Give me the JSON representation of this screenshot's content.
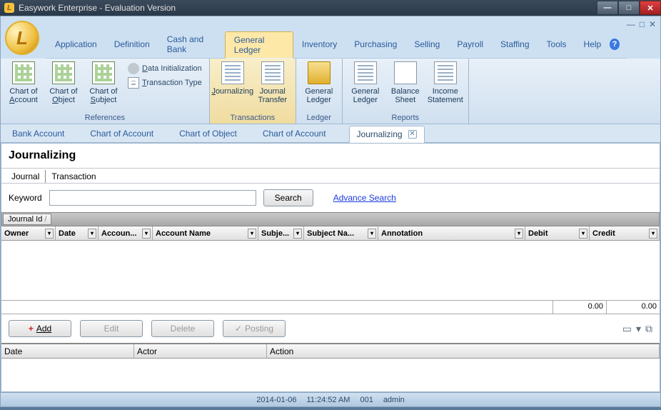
{
  "window_title": "Easywork Enterprise - Evaluation Version",
  "logo_letter": "L",
  "menu": [
    "Application",
    "Definition",
    "Cash and Bank",
    "General Ledger",
    "Inventory",
    "Purchasing",
    "Selling",
    "Payroll",
    "Staffing",
    "Tools",
    "Help"
  ],
  "menu_active": 3,
  "ribbon": {
    "references": {
      "label": "References",
      "items": [
        "Chart of Account",
        "Chart of Object",
        "Chart of Subject"
      ],
      "side": [
        "Data Initialization",
        "Transaction Type"
      ]
    },
    "transactions": {
      "label": "Transactions",
      "items": [
        "Journalizing",
        "Journal Transfer"
      ]
    },
    "ledger": {
      "label": "Ledger",
      "items": [
        "General Ledger"
      ]
    },
    "reports": {
      "label": "Reports",
      "items": [
        "General Ledger",
        "Balance Sheet",
        "Income Statement"
      ]
    }
  },
  "subtabs": [
    "Bank Account",
    "Chart of Account",
    "Chart of Object",
    "Chart of Account",
    "Journalizing"
  ],
  "subtab_active": 4,
  "page": {
    "title": "Journalizing",
    "inner_tabs": [
      "Journal",
      "Transaction"
    ],
    "keyword_label": "Keyword",
    "search_btn": "Search",
    "adv_search": "Advance Search"
  },
  "grid": {
    "group_col": "Journal Id",
    "columns": [
      "Owner",
      "Date",
      "Accoun...",
      "Account Name",
      "Subje...",
      "Subject Na...",
      "Annotation",
      "Debit",
      "Credit"
    ],
    "sums": {
      "debit": "0.00",
      "credit": "0.00"
    }
  },
  "actions": {
    "add": "Add",
    "edit": "Edit",
    "delete": "Delete",
    "posting": "Posting"
  },
  "log_columns": [
    "Date",
    "Actor",
    "Action"
  ],
  "status": {
    "date": "2014-01-06",
    "time": "11:24:52 AM",
    "code": "001",
    "user": "admin"
  }
}
